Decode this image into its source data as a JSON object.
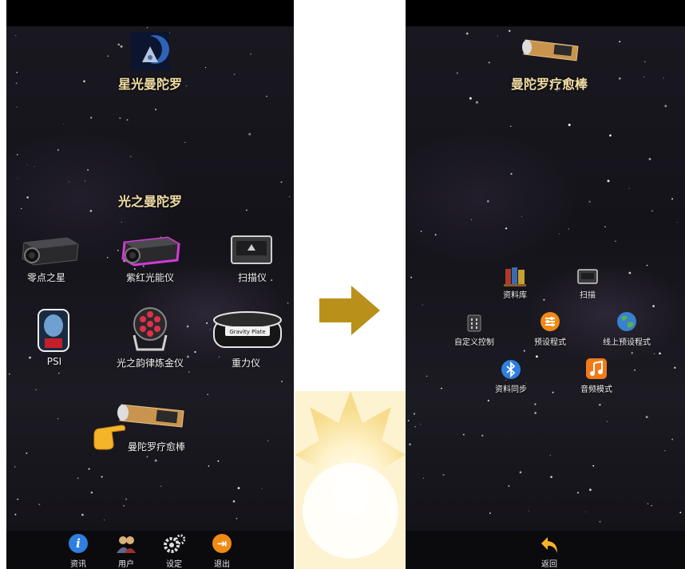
{
  "left": {
    "logo_title": "星光曼陀罗",
    "section_title": "光之曼陀罗",
    "devices": [
      {
        "label": "零点之星",
        "icon": "projector-icon"
      },
      {
        "label": "紫红光能仪",
        "icon": "purple-projector-icon"
      },
      {
        "label": "扫描仪",
        "icon": "scanner-icon"
      },
      {
        "label": "PSI",
        "icon": "head-icon"
      },
      {
        "label": "光之韵律炼金仪",
        "icon": "led-spotlight-icon"
      },
      {
        "label": "重力仪",
        "icon": "gravity-plate-icon"
      },
      {
        "label": "曼陀罗疗愈棒",
        "icon": "healing-wand-icon"
      }
    ],
    "gravity_plate_text": "Gravity Plate",
    "nav": [
      {
        "label": "资讯",
        "icon": "info-icon",
        "color": "#2f7fe0"
      },
      {
        "label": "用户",
        "icon": "users-icon",
        "color": "#d8d8d8"
      },
      {
        "label": "设定",
        "icon": "gear-icon",
        "color": "#e0e0e0"
      },
      {
        "label": "退出",
        "icon": "exit-icon",
        "color": "#f08a16"
      }
    ]
  },
  "right": {
    "title": "曼陀罗疗愈棒",
    "menu": [
      {
        "label": "资料库",
        "icon": "books-icon"
      },
      {
        "label": "扫描",
        "icon": "scanner-small-icon"
      },
      {
        "label": "自定义控制",
        "icon": "chip-icon"
      },
      {
        "label": "预设程式",
        "icon": "sliders-icon"
      },
      {
        "label": "线上预设程式",
        "icon": "globe-icon"
      },
      {
        "label": "资料同步",
        "icon": "bluetooth-icon"
      },
      {
        "label": "音频模式",
        "icon": "music-icon"
      }
    ],
    "back": {
      "label": "返回",
      "icon": "back-arrow-icon"
    }
  },
  "colors": {
    "title_gold": "#f3dfa4",
    "arrow": "#b8901a",
    "accent_orange": "#f08a16"
  }
}
